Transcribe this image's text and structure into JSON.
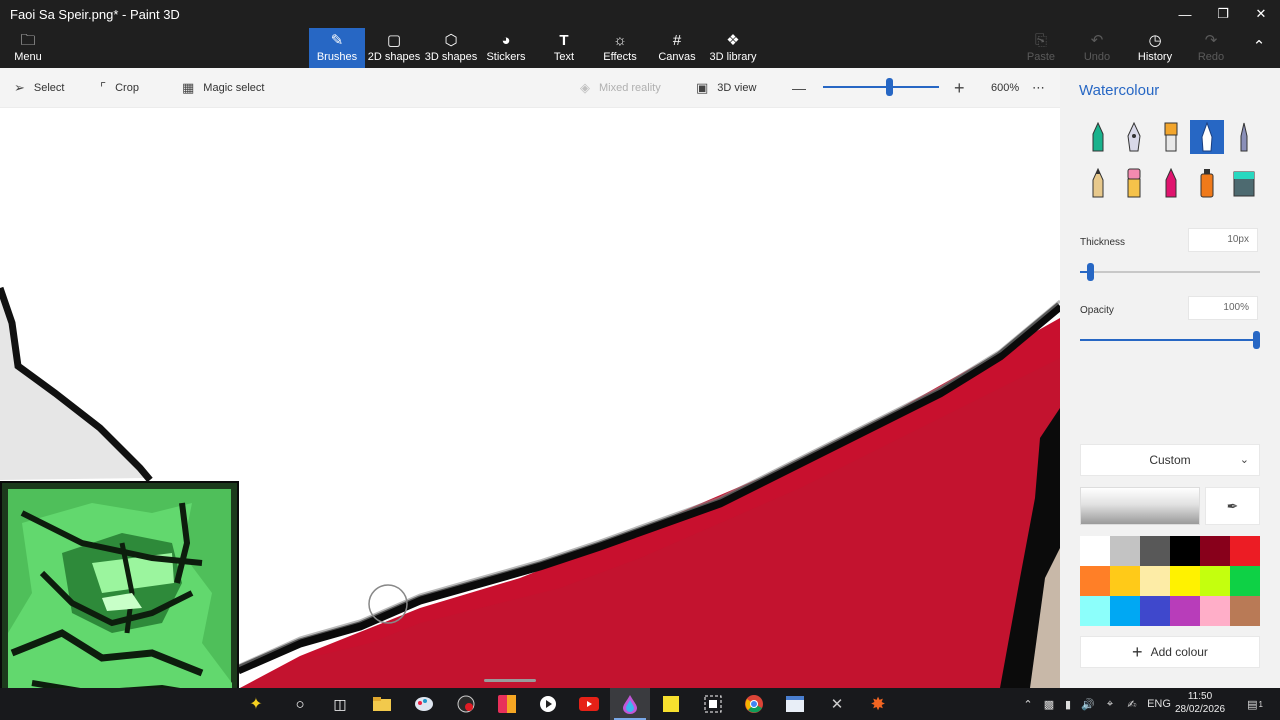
{
  "window": {
    "title": "Faoi Sa Speir.png* - Paint 3D"
  },
  "ribbon": {
    "menu": "Menu",
    "tabs": [
      {
        "label": "Brushes",
        "icon": "brush-icon",
        "active": true
      },
      {
        "label": "2D shapes",
        "icon": "2d-shapes-icon"
      },
      {
        "label": "3D shapes",
        "icon": "3d-shapes-icon"
      },
      {
        "label": "Stickers",
        "icon": "stickers-icon"
      },
      {
        "label": "Text",
        "icon": "text-icon"
      },
      {
        "label": "Effects",
        "icon": "effects-icon"
      },
      {
        "label": "Canvas",
        "icon": "canvas-icon"
      },
      {
        "label": "3D library",
        "icon": "3d-library-icon"
      }
    ],
    "paste": "Paste",
    "undo": "Undo",
    "history": "History",
    "redo": "Redo"
  },
  "toolbar": {
    "select": "Select",
    "crop": "Crop",
    "magic_select": "Magic select",
    "mixed_reality": "Mixed reality",
    "view_3d": "3D view",
    "zoom": "600%",
    "zoom_level": 0.58
  },
  "panel": {
    "title": "Watercolour",
    "brushes": [
      "marker",
      "calligraphy-pen",
      "oil-brush",
      "watercolour",
      "pixel-pen",
      "pencil",
      "eraser",
      "crayon",
      "spray-can",
      "fill"
    ],
    "selected_brush": "watercolour",
    "thickness_label": "Thickness",
    "thickness_value": "10px",
    "thickness_level": 0.04,
    "opacity_label": "Opacity",
    "opacity_value": "100%",
    "opacity_level": 1.0,
    "colour_mode": "Custom",
    "swatches": [
      "#ffffff",
      "#c3c3c3",
      "#585858",
      "#000000",
      "#88001b",
      "#ec1c24",
      "#ff7f27",
      "#ffca18",
      "#fdeca6",
      "#fff200",
      "#c4ff0e",
      "#0ed145",
      "#8cfffb",
      "#00a8f3",
      "#3f48cc",
      "#b83dba",
      "#ffaec8",
      "#b97a56"
    ],
    "add_colour": "Add colour"
  },
  "taskbar": {
    "language": "ENG",
    "time": "11:50",
    "date": "28/02/2026",
    "notifications": "1"
  }
}
